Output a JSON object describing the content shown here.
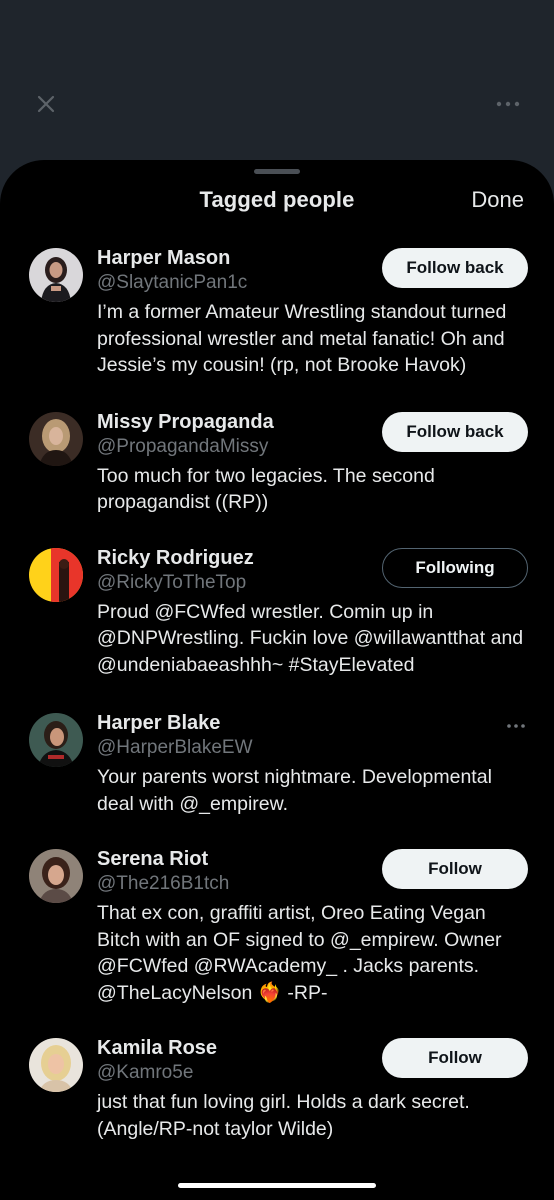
{
  "topbar": {
    "close_icon": "close-icon",
    "more_icon": "more-horizontal-icon"
  },
  "sheet": {
    "title": "Tagged people",
    "done_label": "Done"
  },
  "users": [
    {
      "name": "Harper Mason",
      "handle": "@SlaytanicPan1c",
      "bio": "I’m a former Amateur Wrestling standout turned professional wrestler and metal fanatic! Oh and Jessie’s my cousin! (rp, not Brooke Havok)",
      "button": "Follow back"
    },
    {
      "name": "Missy Propaganda",
      "handle": "@PropagandaMissy",
      "bio": "Too much for two legacies. The second propagandist ((RP))",
      "button": "Follow back"
    },
    {
      "name": "Ricky Rodriguez",
      "handle": "@RickyToTheTop",
      "bio": "Proud @FCWfed wrestler. Comin up in @DNPWrestling. Fuckin love @willawantthat and @undeniabaeashhh~ #StayElevated",
      "button": "Following"
    },
    {
      "name": "Harper Blake",
      "handle": "@HarperBlakeEW",
      "bio": "Your parents worst nightmare. Developmental deal with @_empirew.",
      "button": ""
    },
    {
      "name": "Serena Riot",
      "handle": "@The216B1tch",
      "bio": "That ex con, graffiti artist, Oreo Eating Vegan Bitch with an OF signed to @_empirew. Owner @FCWfed @RWAcademy_ . Jacks parents. @TheLacyNelson ❤️‍🔥 -RP-",
      "button": "Follow"
    },
    {
      "name": "Kamila Rose",
      "handle": "@Kamro5e",
      "bio": "just that fun loving girl. Holds a dark secret. (Angle/RP-not taylor Wilde)",
      "button": "Follow"
    }
  ],
  "colors": {
    "backdrop": "#1f252c",
    "sheet": "#000000",
    "text_primary": "#e7e9ea",
    "text_secondary": "#71767b",
    "button_light": "#eff3f4",
    "button_border": "#536471"
  }
}
